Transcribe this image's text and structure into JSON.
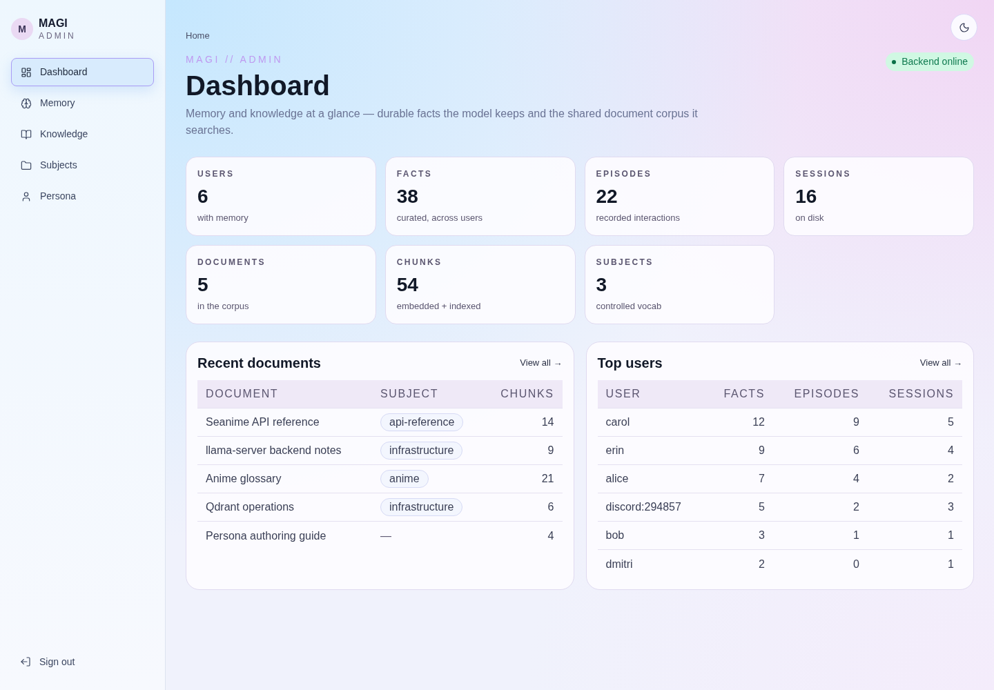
{
  "sidebar": {
    "brand": {
      "initial": "M",
      "name": "MAGI",
      "subtitle": "ADMIN"
    },
    "items": [
      {
        "label": "Dashboard",
        "selected": true
      },
      {
        "label": "Memory",
        "selected": false
      },
      {
        "label": "Knowledge",
        "selected": false
      },
      {
        "label": "Subjects",
        "selected": false
      },
      {
        "label": "Persona",
        "selected": false
      }
    ],
    "sign_out": {
      "label": "Sign out"
    }
  },
  "header": {
    "breadcrumb": "Home",
    "eyebrow": "MAGI // ADMIN",
    "title": "Dashboard",
    "description": "Memory and knowledge at a glance — durable facts the model keeps and the shared document corpus it searches.",
    "status": {
      "label": "Backend online",
      "online": true
    }
  },
  "stats": [
    {
      "label": "USERS",
      "value": "6",
      "caption": "with memory"
    },
    {
      "label": "FACTS",
      "value": "38",
      "caption": "curated, across users"
    },
    {
      "label": "EPISODES",
      "value": "22",
      "caption": "recorded interactions"
    },
    {
      "label": "SESSIONS",
      "value": "16",
      "caption": "on disk"
    },
    {
      "label": "DOCUMENTS",
      "value": "5",
      "caption": "in the corpus"
    },
    {
      "label": "CHUNKS",
      "value": "54",
      "caption": "embedded + indexed"
    },
    {
      "label": "SUBJECTS",
      "value": "3",
      "caption": "controlled vocab"
    }
  ],
  "recent_documents": {
    "title": "Recent documents",
    "link": "View all →",
    "columns": [
      "DOCUMENT",
      "SUBJECT",
      "CHUNKS"
    ],
    "rows": [
      {
        "document": "Seanime API reference",
        "subject": {
          "kind": "tag",
          "text": "api-reference"
        },
        "chunks": "14"
      },
      {
        "document": "llama-server backend notes",
        "subject": {
          "kind": "tag",
          "text": "infrastructure"
        },
        "chunks": "9"
      },
      {
        "document": "Anime glossary",
        "subject": {
          "kind": "tag",
          "text": "anime"
        },
        "chunks": "21"
      },
      {
        "document": "Qdrant operations",
        "subject": {
          "kind": "tag",
          "text": "infrastructure"
        },
        "chunks": "6"
      },
      {
        "document": "Persona authoring guide",
        "subject": {
          "kind": "none",
          "text": "—"
        },
        "chunks": "4"
      }
    ]
  },
  "top_users": {
    "title": "Top users",
    "link": "View all →",
    "columns": [
      "USER",
      "FACTS",
      "EPISODES",
      "SESSIONS"
    ],
    "rows": [
      {
        "user": "carol",
        "facts": "12",
        "episodes": "9",
        "sessions": "5"
      },
      {
        "user": "erin",
        "facts": "9",
        "episodes": "6",
        "sessions": "4"
      },
      {
        "user": "alice",
        "facts": "7",
        "episodes": "4",
        "sessions": "2"
      },
      {
        "user": "discord:294857",
        "facts": "5",
        "episodes": "2",
        "sessions": "3"
      },
      {
        "user": "bob",
        "facts": "3",
        "episodes": "1",
        "sessions": "1"
      },
      {
        "user": "dmitri",
        "facts": "2",
        "episodes": "0",
        "sessions": "1"
      }
    ]
  }
}
